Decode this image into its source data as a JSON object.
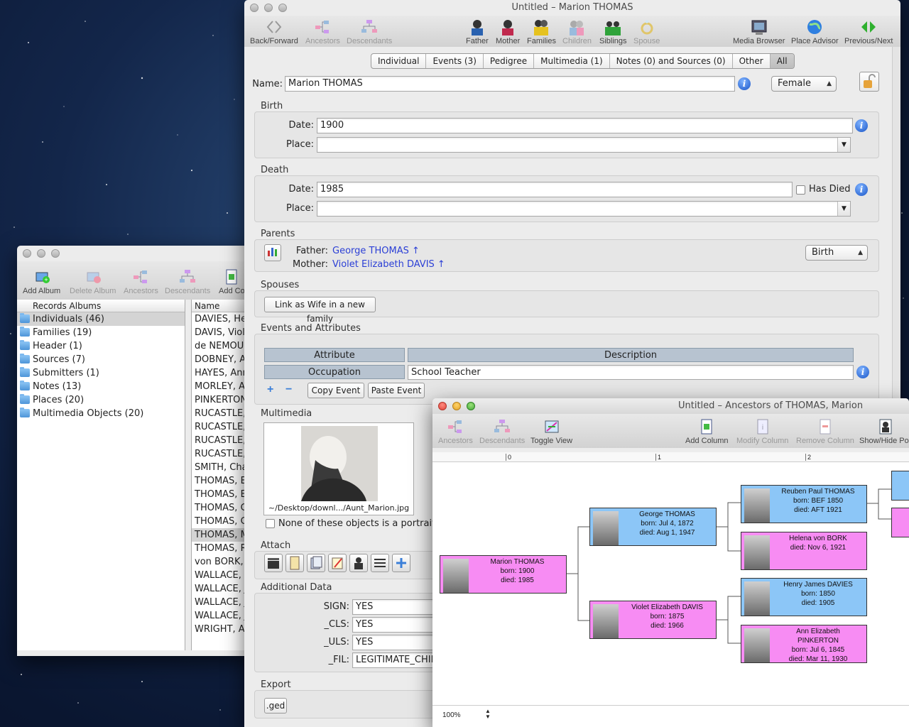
{
  "albums_window": {
    "toolbar": [
      "Add Album",
      "Delete Album",
      "Ancestors",
      "Descendants",
      "Add Co"
    ],
    "albums_header": "Records Albums",
    "albums": [
      "Individuals (46)",
      "Families (19)",
      "Header (1)",
      "Sources (7)",
      "Submitters (1)",
      "Notes (13)",
      "Places (20)",
      "Multimedia Objects (20)"
    ],
    "name_header": "Name",
    "names": [
      "DAVIES, Hen",
      "DAVIS, Viole",
      "de NEMOUR",
      "DOBNEY, An",
      "HAYES, Ann",
      "MORLEY, An",
      "PINKERTON,",
      "RUCASTLE, A",
      "RUCASTLE, A",
      "RUCASTLE, C",
      "RUCASTLE, F",
      "SMITH, Char",
      "THOMAS, Ed",
      "THOMAS, El",
      "THOMAS, Ge",
      "THOMAS, Ge",
      "THOMAS, M",
      "THOMAS, Re",
      "von BORK, H",
      "WALLACE, B",
      "WALLACE, Ja",
      "WALLACE, Ja",
      "WALLACE, Ja",
      "WRIGHT, An"
    ]
  },
  "main_window": {
    "title": "Untitled – Marion THOMAS",
    "toolbar_left": [
      "Back/Forward",
      "Ancestors",
      "Descendants"
    ],
    "toolbar_mid": [
      "Father",
      "Mother",
      "Families",
      "Children",
      "Siblings",
      "Spouse"
    ],
    "toolbar_right": [
      "Media Browser",
      "Place Advisor",
      "Previous/Next"
    ],
    "tabs": [
      "Individual",
      "Events (3)",
      "Pedigree",
      "Multimedia (1)",
      "Notes (0) and Sources (0)",
      "Other",
      "All"
    ],
    "name_label": "Name:",
    "name_value": "Marion THOMAS",
    "sex": "Female",
    "birth": {
      "title": "Birth",
      "date_label": "Date:",
      "date": "1900",
      "place_label": "Place:",
      "place": ""
    },
    "death": {
      "title": "Death",
      "date_label": "Date:",
      "date": "1985",
      "place_label": "Place:",
      "place": "",
      "has_died": "Has Died"
    },
    "parents": {
      "title": "Parents",
      "father_label": "Father:",
      "father": "George THOMAS ↑",
      "mother_label": "Mother:",
      "mother": "Violet Elizabeth DAVIS ↑",
      "relation": "Birth"
    },
    "spouses": {
      "title": "Spouses",
      "link_btn": "Link as Wife in a new family"
    },
    "events": {
      "title": "Events and Attributes",
      "col_attr": "Attribute",
      "col_desc": "Description",
      "attr": "Occupation",
      "desc": "School Teacher",
      "copy": "Copy Event",
      "paste": "Paste Event"
    },
    "multimedia": {
      "title": "Multimedia",
      "path": "~/Desktop/downl.../Aunt_Marion.jpg",
      "portrait": "None of these objects is a portrait"
    },
    "attach": {
      "title": "Attach"
    },
    "additional": {
      "title": "Additional Data",
      "rows": [
        {
          "k": "SIGN:",
          "v": "YES"
        },
        {
          "k": "_CLS:",
          "v": "YES"
        },
        {
          "k": "_ULS:",
          "v": "YES"
        },
        {
          "k": "_FIL:",
          "v": "LEGITIMATE_CHILD"
        }
      ]
    },
    "export": {
      "title": "Export",
      "btn": ".ged"
    }
  },
  "tree_window": {
    "title": "Untitled – Ancestors of THOMAS, Marion",
    "toolbar": [
      "Ancestors",
      "Descendants",
      "Toggle View",
      "Add Column",
      "Modify Column",
      "Remove Column",
      "Show/Hide Por"
    ],
    "ruler": [
      "0",
      "1",
      "2"
    ],
    "zoom": "100%",
    "nodes": {
      "marion": [
        "Marion THOMAS",
        "born: 1900",
        "died: 1985"
      ],
      "george": [
        "George THOMAS",
        "born: Jul 4, 1872",
        "died: Aug 1, 1947"
      ],
      "violet": [
        "Violet Elizabeth DAVIS",
        "born: 1875",
        "died: 1966"
      ],
      "reuben": [
        "Reuben Paul THOMAS",
        "born: BEF 1850",
        "died: AFT 1921"
      ],
      "helena": [
        "Helena von BORK",
        "died: Nov 6, 1921"
      ],
      "henry": [
        "Henry James DAVIES",
        "born: 1850",
        "died: 1905"
      ],
      "ann": [
        "Ann Elizabeth",
        "PINKERTON",
        "born: Jul 6, 1845",
        "died: Mar 11, 1930"
      ]
    }
  },
  "colors": {
    "male": "#8cc6f7",
    "female": "#f78cf3",
    "link": "#2b3fd6"
  }
}
